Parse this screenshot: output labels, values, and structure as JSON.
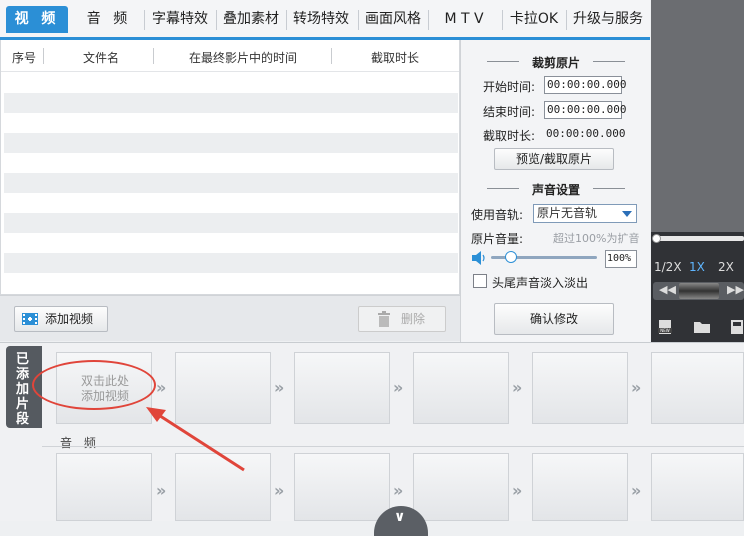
{
  "tabs": [
    {
      "label": "视 频",
      "active": true
    },
    {
      "label": "音 频"
    },
    {
      "label": "字幕特效"
    },
    {
      "label": "叠加素材"
    },
    {
      "label": "转场特效"
    },
    {
      "label": "画面风格"
    },
    {
      "label": "M T V"
    },
    {
      "label": "卡拉OK"
    },
    {
      "label": "升级与服务"
    }
  ],
  "list": {
    "columns": [
      "序号",
      "文件名",
      "在最终影片中的时间",
      "截取时长"
    ],
    "add_video_label": "添加视频",
    "delete_label": "删除"
  },
  "crop": {
    "title": "裁剪原片",
    "start_label": "开始时间:",
    "start_value": "00:00:00.000",
    "end_label": "结束时间:",
    "end_value": "00:00:00.000",
    "duration_label": "截取时长:",
    "duration_value": "00:00:00.000",
    "preview_button": "预览/截取原片"
  },
  "audio": {
    "title": "声音设置",
    "track_label": "使用音轨:",
    "track_value": "原片无音轨",
    "volume_label": "原片音量:",
    "volume_hint": "超过100%为扩音",
    "volume_value": "100%",
    "fade_label": "头尾声音淡入淡出",
    "confirm_button": "确认修改"
  },
  "player": {
    "speeds": [
      "1/2X",
      "1X",
      "2X"
    ],
    "active_speed": "1X"
  },
  "timeline": {
    "side_tab": "已添加片段",
    "slot_hint_line1": "双击此处",
    "slot_hint_line2": "添加视频",
    "audio_label": "音 频"
  },
  "colors": {
    "accent": "#2b8fd6",
    "annotation": "#e0453a"
  }
}
